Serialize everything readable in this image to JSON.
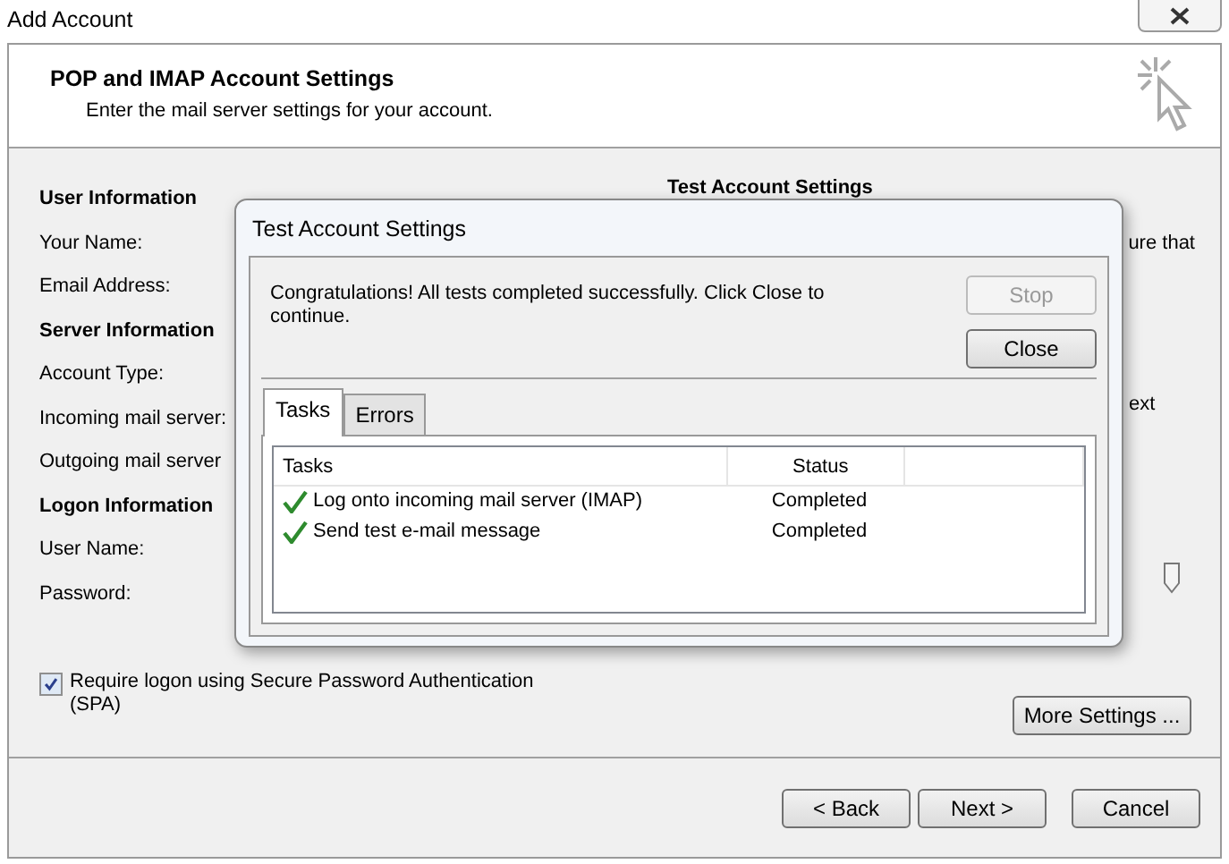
{
  "window": {
    "title": "Add Account"
  },
  "header": {
    "title": "POP and IMAP Account Settings",
    "subtitle": "Enter the mail server settings for your account."
  },
  "sections": [
    {
      "heading": "User Information",
      "fields": [
        {
          "label": "Your Name:"
        },
        {
          "label": "Email Address:"
        }
      ]
    },
    {
      "heading": "Server Information",
      "fields": [
        {
          "label": "Account Type:"
        },
        {
          "label": "Incoming mail server:"
        },
        {
          "label": "Outgoing mail server"
        }
      ]
    },
    {
      "heading": "Logon Information",
      "fields": [
        {
          "label": "User Name:"
        },
        {
          "label": "Password:"
        }
      ]
    }
  ],
  "test_settings": {
    "heading": "Test Account Settings",
    "text_fragment_1": "ure that",
    "text_fragment_2": "ext"
  },
  "spa_checkbox": {
    "label": "Require logon using Secure Password Authentication (SPA)",
    "checked": true
  },
  "more_settings_button": "More Settings ...",
  "footer_buttons": [
    "< Back",
    "Next >",
    "Cancel"
  ],
  "dialog": {
    "title": "Test Account Settings",
    "message": "Congratulations! All tests completed successfully. Click Close to continue.",
    "buttons": [
      {
        "label": "Stop",
        "disabled": true
      },
      {
        "label": "Close",
        "disabled": false
      }
    ],
    "tabs": [
      {
        "label": "Tasks",
        "selected": true
      },
      {
        "label": "Errors",
        "selected": false
      }
    ],
    "columns": [
      "Tasks",
      "Status"
    ],
    "rows": [
      {
        "task": "Log onto incoming mail server (IMAP)",
        "status": "Completed",
        "completed": true
      },
      {
        "task": "Send test e-mail message",
        "status": "Completed",
        "completed": true
      }
    ]
  }
}
